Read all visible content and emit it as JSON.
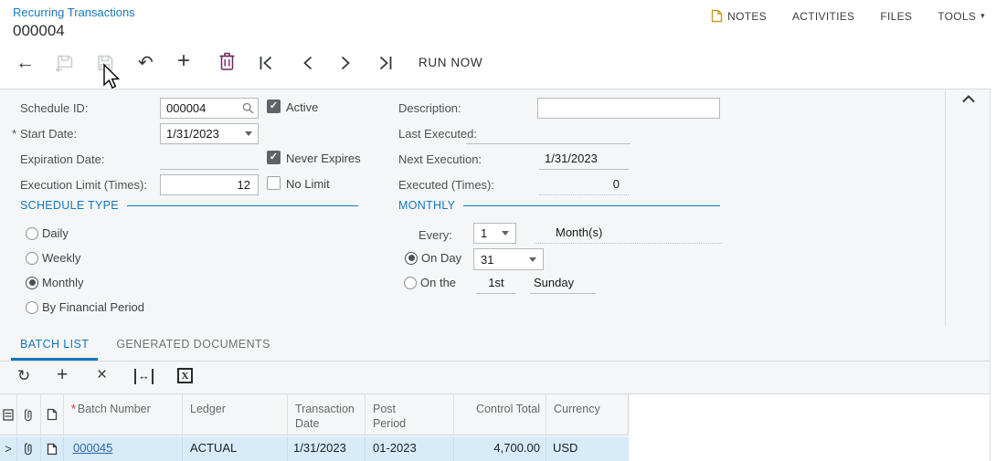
{
  "header": {
    "breadcrumb": "Recurring Transactions",
    "record_id": "000004",
    "menu": {
      "notes": "NOTES",
      "activities": "ACTIVITIES",
      "files": "FILES",
      "tools": "TOOLS"
    },
    "run_now": "RUN NOW"
  },
  "icons": {
    "back": "←",
    "undo": "↶",
    "plus": "+",
    "refresh": "↻",
    "close": "×",
    "fit_width": "↔",
    "caret_down": "▾",
    "excel": "X",
    "row_expand": ">"
  },
  "form": {
    "schedule_id": {
      "label": "Schedule ID:",
      "value": "000004"
    },
    "start_date": {
      "label": "Start Date:",
      "required": "*",
      "value": "1/31/2023"
    },
    "expiration_date": {
      "label": "Expiration Date:",
      "value": ""
    },
    "execution_limit": {
      "label": "Execution Limit (Times):",
      "value": "12"
    },
    "active": {
      "label": "Active",
      "checked": true
    },
    "never_expires": {
      "label": "Never Expires",
      "checked": true
    },
    "no_limit": {
      "label": "No Limit",
      "checked": false
    },
    "description": {
      "label": "Description:",
      "value": ""
    },
    "last_executed": {
      "label": "Last Executed:",
      "value": ""
    },
    "next_execution": {
      "label": "Next Execution:",
      "value": "1/31/2023"
    },
    "executed_times": {
      "label": "Executed (Times):",
      "value": "0"
    }
  },
  "schedule_type": {
    "title": "SCHEDULE TYPE",
    "options": [
      "Daily",
      "Weekly",
      "Monthly",
      "By Financial Period"
    ],
    "selected": "Monthly"
  },
  "monthly": {
    "title": "MONTHLY",
    "every_label": "Every:",
    "every_value": "1",
    "every_unit": "Month(s)",
    "on_day_label": "On Day",
    "on_day_value": "31",
    "on_the_label": "On the",
    "on_the_ordinal": "1st",
    "on_the_weekday": "Sunday",
    "selected": "On Day"
  },
  "tabs": [
    {
      "label": "BATCH LIST",
      "active": true
    },
    {
      "label": "GENERATED DOCUMENTS",
      "active": false
    }
  ],
  "grid": {
    "required_marker": "*",
    "columns": [
      "Batch Number",
      "Ledger",
      "Transaction Date",
      "Post Period",
      "Control Total",
      "Currency"
    ],
    "rows": [
      {
        "batch_number": "000045",
        "ledger": "ACTUAL",
        "transaction_date": "1/31/2023",
        "post_period": "01-2023",
        "control_total": "4,700.00",
        "currency": "USD"
      }
    ]
  },
  "colors": {
    "accent_blue": "#1377bd",
    "link_blue": "#2b66ae",
    "selected_row": "#d7ecf8",
    "trash_icon": "#6e2a5e",
    "panel_bg": "#f5f6f7",
    "notes_icon_gold": "#bfa124"
  }
}
